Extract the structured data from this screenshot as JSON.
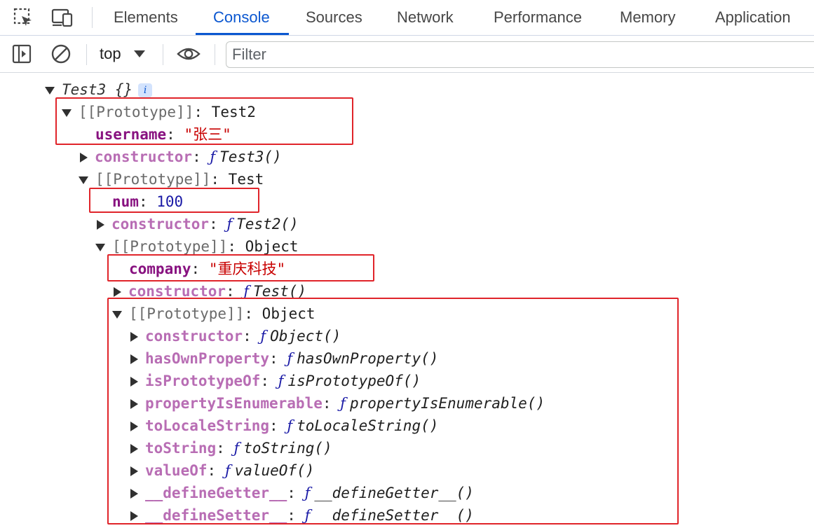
{
  "tabs": [
    {
      "label": "Elements",
      "active": false
    },
    {
      "label": "Console",
      "active": true
    },
    {
      "label": "Sources",
      "active": false
    },
    {
      "label": "Network",
      "active": false
    },
    {
      "label": "Performance",
      "active": false
    },
    {
      "label": "Memory",
      "active": false
    },
    {
      "label": "Application",
      "active": false
    }
  ],
  "toolbar": {
    "context": "top",
    "filter_placeholder": "Filter",
    "filter_value": ""
  },
  "console": {
    "root": {
      "title": "Test3 {}",
      "badge": "i"
    },
    "proto1": {
      "key": "[[Prototype]]",
      "value": "Test2"
    },
    "username": {
      "key": "username",
      "value": "\"张三\""
    },
    "ctor1": {
      "key": "constructor",
      "fn_glyph": "ƒ",
      "value": "Test3()"
    },
    "proto2": {
      "key": "[[Prototype]]",
      "value": "Test"
    },
    "num": {
      "key": "num",
      "value": "100"
    },
    "ctor2": {
      "key": "constructor",
      "fn_glyph": "ƒ",
      "value": "Test2()"
    },
    "proto3": {
      "key": "[[Prototype]]",
      "value": "Object"
    },
    "company": {
      "key": "company",
      "value": "\"重庆科技\""
    },
    "ctor3": {
      "key": "constructor",
      "fn_glyph": "ƒ",
      "value": "Test()"
    },
    "proto4": {
      "key": "[[Prototype]]",
      "value": "Object"
    },
    "object_methods": [
      {
        "key": "constructor",
        "fn_glyph": "ƒ",
        "value": "Object()"
      },
      {
        "key": "hasOwnProperty",
        "fn_glyph": "ƒ",
        "value": "hasOwnProperty()"
      },
      {
        "key": "isPrototypeOf",
        "fn_glyph": "ƒ",
        "value": "isPrototypeOf()"
      },
      {
        "key": "propertyIsEnumerable",
        "fn_glyph": "ƒ",
        "value": "propertyIsEnumerable()"
      },
      {
        "key": "toLocaleString",
        "fn_glyph": "ƒ",
        "value": "toLocaleString()"
      },
      {
        "key": "toString",
        "fn_glyph": "ƒ",
        "value": "toString()"
      },
      {
        "key": "valueOf",
        "fn_glyph": "ƒ",
        "value": "valueOf()"
      },
      {
        "key": "__defineGetter__",
        "fn_glyph": "ƒ",
        "value": "__defineGetter__()"
      },
      {
        "key": "__defineSetter__",
        "fn_glyph": "ƒ",
        "value": "__defineSetter__()"
      }
    ]
  },
  "colors": {
    "accent": "#0b57d0",
    "own_property": "#881280",
    "inherited_property": "#b86db4",
    "string": "#c80000",
    "number": "#1a1aa6",
    "annotation_box": "#e0242a"
  }
}
